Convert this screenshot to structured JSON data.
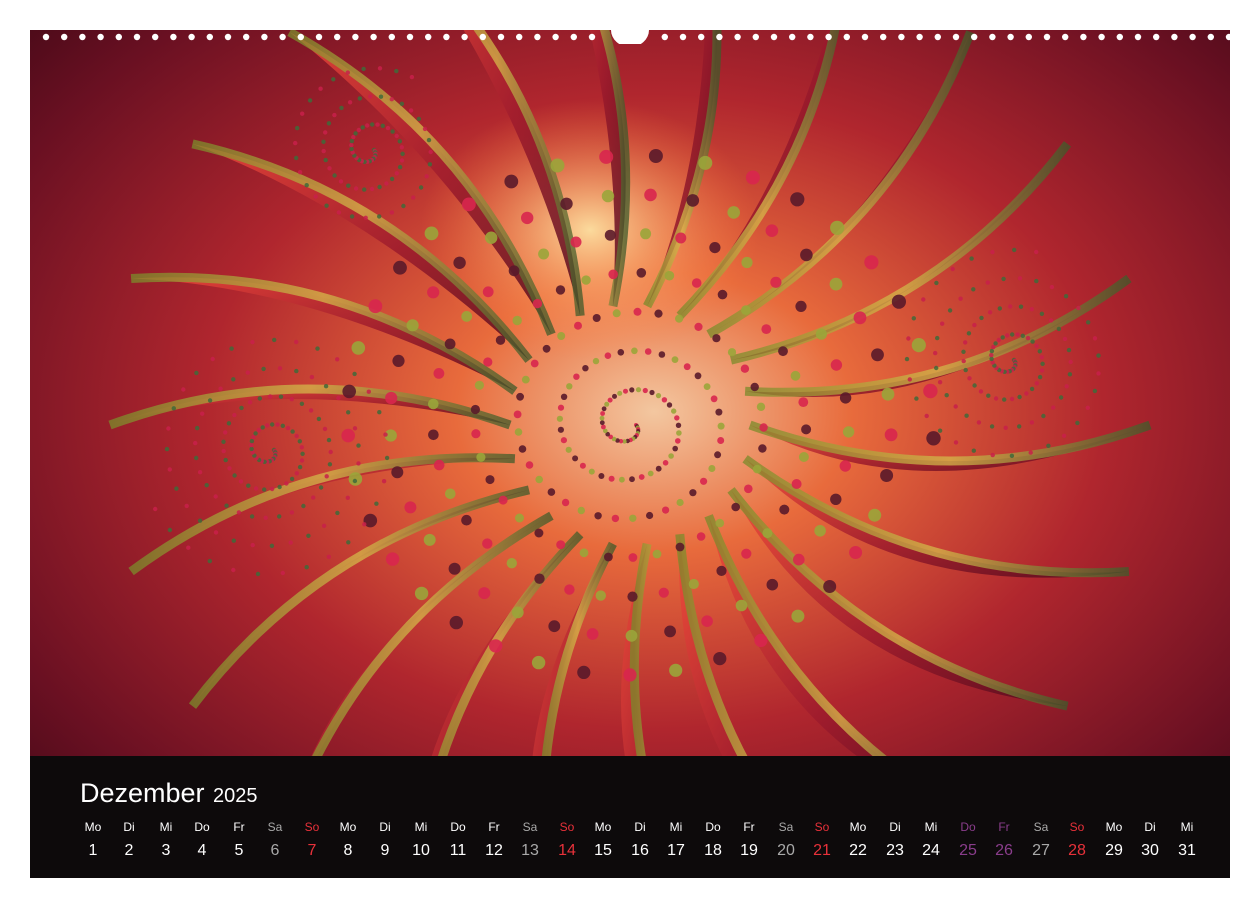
{
  "calendar": {
    "month": "Dezember",
    "year": "2025",
    "days": [
      {
        "weekday": "Mo",
        "day": "1",
        "type": "weekday"
      },
      {
        "weekday": "Di",
        "day": "2",
        "type": "weekday"
      },
      {
        "weekday": "Mi",
        "day": "3",
        "type": "weekday"
      },
      {
        "weekday": "Do",
        "day": "4",
        "type": "weekday"
      },
      {
        "weekday": "Fr",
        "day": "5",
        "type": "weekday"
      },
      {
        "weekday": "Sa",
        "day": "6",
        "type": "sat"
      },
      {
        "weekday": "So",
        "day": "7",
        "type": "sun"
      },
      {
        "weekday": "Mo",
        "day": "8",
        "type": "weekday"
      },
      {
        "weekday": "Di",
        "day": "9",
        "type": "weekday"
      },
      {
        "weekday": "Mi",
        "day": "10",
        "type": "weekday"
      },
      {
        "weekday": "Do",
        "day": "11",
        "type": "weekday"
      },
      {
        "weekday": "Fr",
        "day": "12",
        "type": "weekday"
      },
      {
        "weekday": "Sa",
        "day": "13",
        "type": "sat"
      },
      {
        "weekday": "So",
        "day": "14",
        "type": "sun"
      },
      {
        "weekday": "Mo",
        "day": "15",
        "type": "weekday"
      },
      {
        "weekday": "Di",
        "day": "16",
        "type": "weekday"
      },
      {
        "weekday": "Mi",
        "day": "17",
        "type": "weekday"
      },
      {
        "weekday": "Do",
        "day": "18",
        "type": "weekday"
      },
      {
        "weekday": "Fr",
        "day": "19",
        "type": "weekday"
      },
      {
        "weekday": "Sa",
        "day": "20",
        "type": "sat"
      },
      {
        "weekday": "So",
        "day": "21",
        "type": "sun"
      },
      {
        "weekday": "Mo",
        "day": "22",
        "type": "weekday"
      },
      {
        "weekday": "Di",
        "day": "23",
        "type": "weekday"
      },
      {
        "weekday": "Mi",
        "day": "24",
        "type": "weekday"
      },
      {
        "weekday": "Do",
        "day": "25",
        "type": "holiday"
      },
      {
        "weekday": "Fr",
        "day": "26",
        "type": "holiday"
      },
      {
        "weekday": "Sa",
        "day": "27",
        "type": "sat"
      },
      {
        "weekday": "So",
        "day": "28",
        "type": "sun"
      },
      {
        "weekday": "Mo",
        "day": "29",
        "type": "weekday"
      },
      {
        "weekday": "Di",
        "day": "30",
        "type": "weekday"
      },
      {
        "weekday": "Mi",
        "day": "31",
        "type": "weekday"
      }
    ]
  },
  "colors": {
    "band_background": "#0d0a0b",
    "text": "#ffffff",
    "saturday": "#a9a9a9",
    "sunday": "#e8313a",
    "holiday": "#8a3d8c"
  },
  "artwork": {
    "icon": "fractal-spiral-artwork"
  }
}
